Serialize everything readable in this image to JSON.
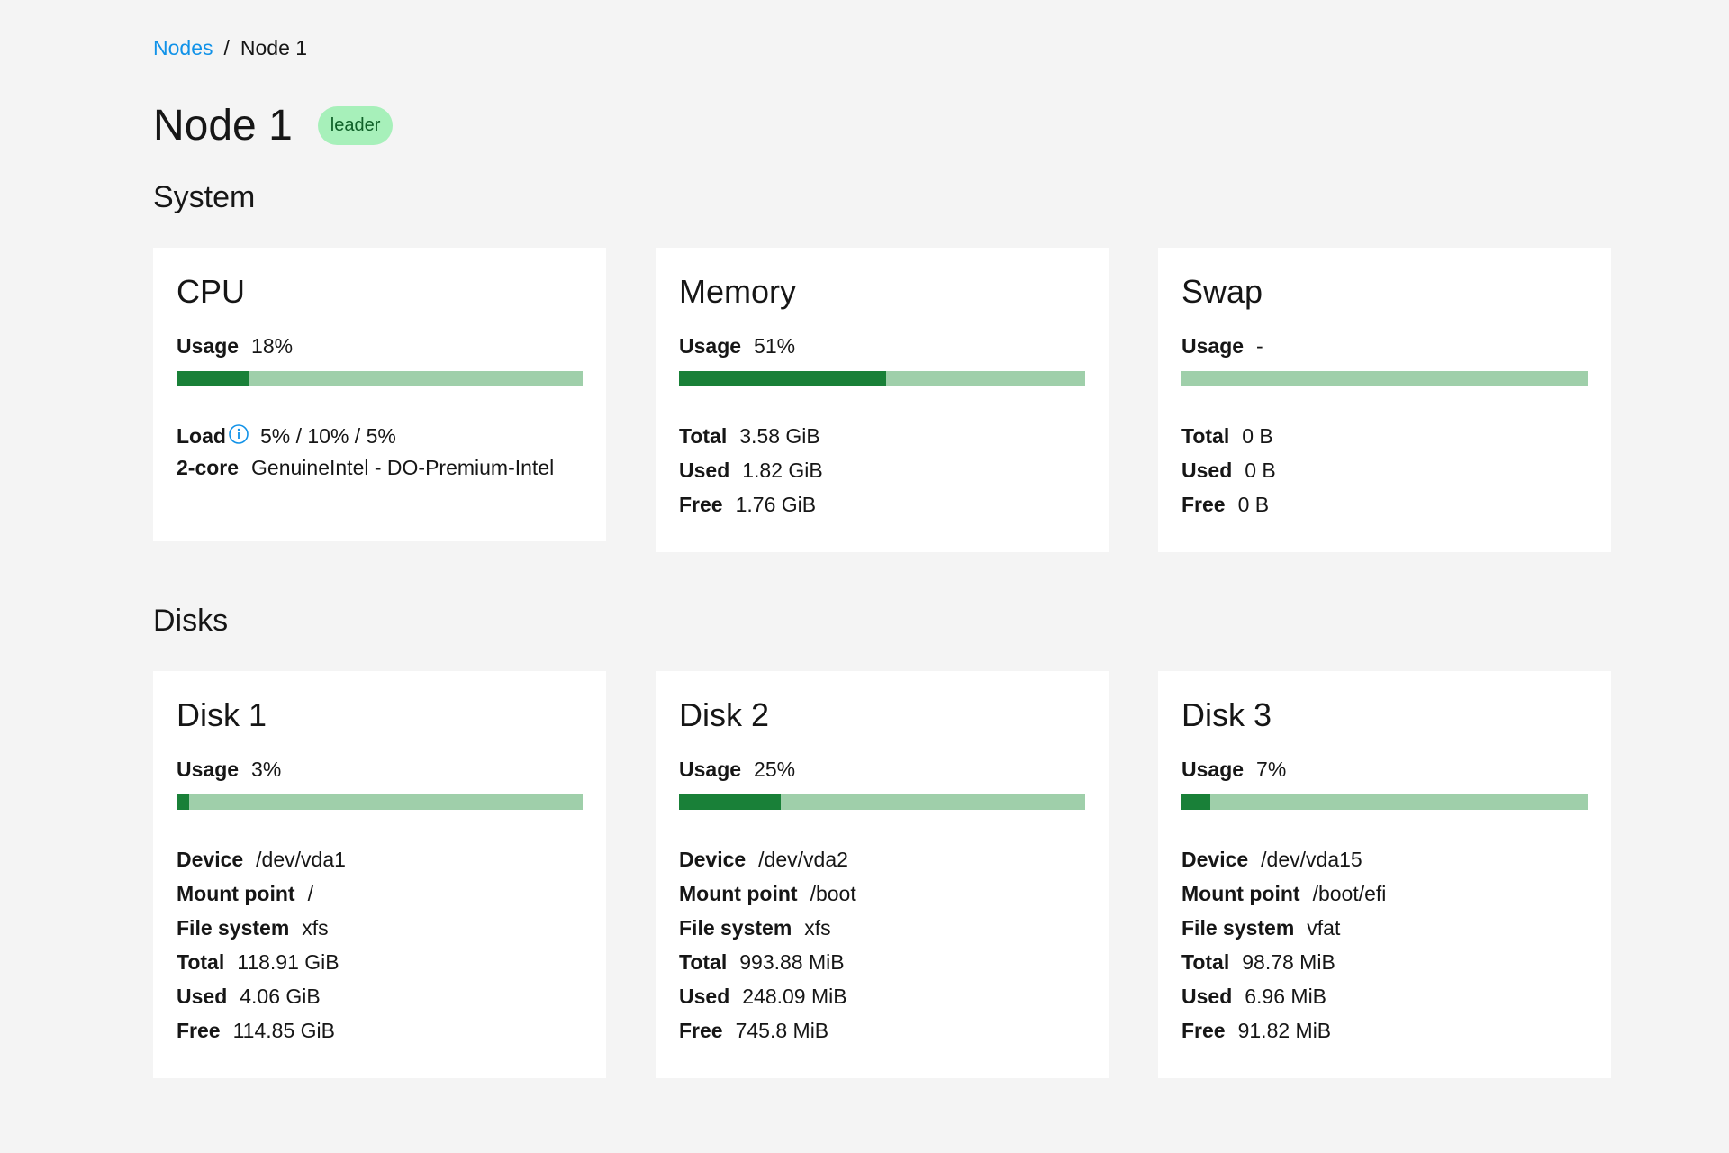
{
  "breadcrumb": {
    "parent": "Nodes",
    "separator": "/",
    "current": "Node 1"
  },
  "page": {
    "title": "Node 1",
    "badge": "leader"
  },
  "sections": {
    "system": "System",
    "disks": "Disks"
  },
  "labels": {
    "usage": "Usage",
    "load": "Load",
    "total": "Total",
    "used": "Used",
    "free": "Free",
    "device": "Device",
    "mount_point": "Mount point",
    "file_system": "File system"
  },
  "cpu": {
    "title": "CPU",
    "usage": "18%",
    "usage_fraction": 0.18,
    "load": "5% / 10% / 5%",
    "cores_label": "2-core",
    "model": "GenuineIntel - DO-Premium-Intel"
  },
  "memory": {
    "title": "Memory",
    "usage": "51%",
    "usage_fraction": 0.51,
    "total": "3.58 GiB",
    "used": "1.82 GiB",
    "free": "1.76 GiB"
  },
  "swap": {
    "title": "Swap",
    "usage": "-",
    "usage_fraction": 0,
    "total": "0 B",
    "used": "0 B",
    "free": "0 B"
  },
  "disks": [
    {
      "title": "Disk 1",
      "usage": "3%",
      "usage_fraction": 0.03,
      "device": "/dev/vda1",
      "mount_point": "/",
      "file_system": "xfs",
      "total": "118.91 GiB",
      "used": "4.06 GiB",
      "free": "114.85 GiB"
    },
    {
      "title": "Disk 2",
      "usage": "25%",
      "usage_fraction": 0.25,
      "device": "/dev/vda2",
      "mount_point": "/boot",
      "file_system": "xfs",
      "total": "993.88 MiB",
      "used": "248.09 MiB",
      "free": "745.8 MiB"
    },
    {
      "title": "Disk 3",
      "usage": "7%",
      "usage_fraction": 0.07,
      "device": "/dev/vda15",
      "mount_point": "/boot/efi",
      "file_system": "vfat",
      "total": "98.78 MiB",
      "used": "6.96 MiB",
      "free": "91.82 MiB"
    }
  ],
  "colors": {
    "accent_link": "#1192e8",
    "bar_fill": "#198038",
    "bar_track": "#9fcfaa",
    "badge_bg": "#a7f0ba"
  },
  "icons": {
    "load_info": "info-circle-icon"
  }
}
